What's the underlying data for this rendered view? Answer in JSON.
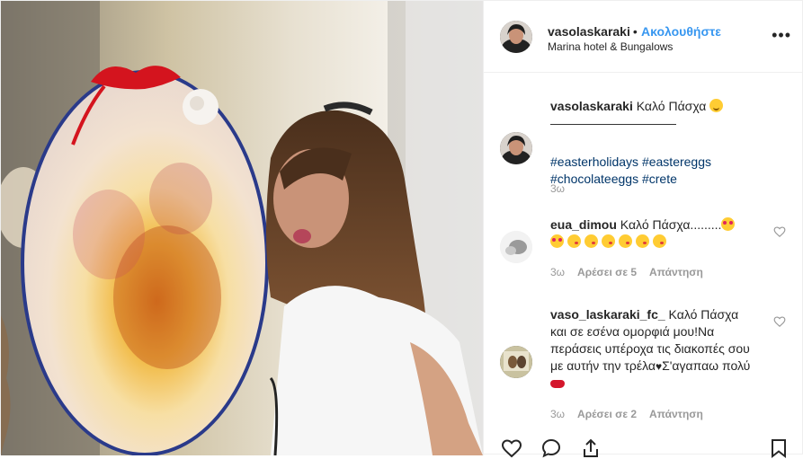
{
  "post": {
    "author": "vasolaskaraki",
    "separator": "•",
    "follow_label": "Ακολουθήστε",
    "location": "Marina hotel & Bungalows",
    "more_label": "•••"
  },
  "caption": {
    "user": "vasolaskaraki",
    "text": " Καλό Πάσχα ",
    "rule": "——————————",
    "hashtags": [
      "#easterholidays",
      "#eastereggs",
      "#chocolateeggs",
      "#crete"
    ],
    "age": "3ω"
  },
  "comments": [
    {
      "user": "eua_dimou",
      "text": " Καλό Πάσχα.........",
      "age": "3ω",
      "likes": "Αρέσει σε 5",
      "reply": "Απάντηση"
    },
    {
      "user": "vaso_laskaraki_fc_",
      "text": " Καλό Πάσχα και σε εσένα ομορφιά μου!Να περάσεις υπέροχα τις διακοπές σου με αυτήν την τρέλα",
      "text2": "Σ'αγαπαω πολύ",
      "age": "3ω",
      "likes": "Αρέσει σε 2",
      "reply": "Απάντηση"
    }
  ],
  "icons": {
    "like": "heart-outline-icon",
    "comment": "speech-bubble-icon",
    "share": "share-icon",
    "save": "bookmark-icon"
  },
  "colors": {
    "link": "#3897f0",
    "hashtag": "#003569",
    "muted": "#999999",
    "border": "#efefef"
  }
}
